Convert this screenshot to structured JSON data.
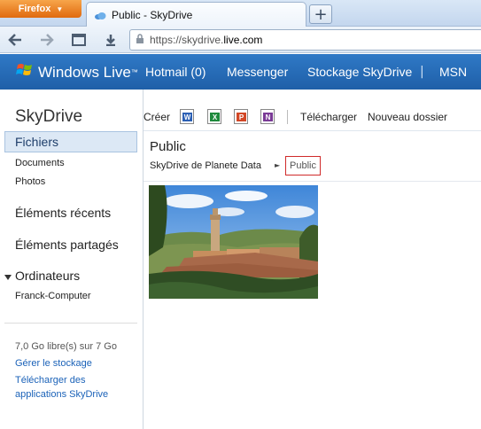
{
  "browser": {
    "app_button": "Firefox",
    "tab_title": "Public - SkyDrive",
    "new_tab_label": "+",
    "url_prefix": "https://skydrive.",
    "url_host": "live.com"
  },
  "header": {
    "brand": "Windows Live",
    "brand_tm": "™",
    "links": [
      "Hotmail (0)",
      "Messenger",
      "Stockage SkyDrive",
      "MSN"
    ],
    "separator": "|"
  },
  "sidebar": {
    "title": "SkyDrive",
    "selected": "Fichiers",
    "sub_items": [
      "Documents",
      "Photos"
    ],
    "recent": "Éléments récents",
    "shared": "Éléments partagés",
    "computers": "Ordinateurs",
    "computer_name": "Franck-Computer",
    "storage": "7,0 Go libre(s) sur 7 Go",
    "manage_storage": "Gérer le stockage",
    "download_apps_line1": "Télécharger des",
    "download_apps_line2": "applications SkyDrive"
  },
  "toolbar": {
    "create": "Créer",
    "doc_icons": [
      {
        "name": "word-doc-icon",
        "letter": "W",
        "color": "#2b5fb4"
      },
      {
        "name": "excel-doc-icon",
        "letter": "X",
        "color": "#1e8a3c"
      },
      {
        "name": "powerpoint-doc-icon",
        "letter": "P",
        "color": "#d24726"
      },
      {
        "name": "onenote-doc-icon",
        "letter": "N",
        "color": "#7a3b96"
      }
    ],
    "upload": "Télécharger",
    "new_folder": "Nouveau dossier"
  },
  "main": {
    "folder_title": "Public",
    "breadcrumb_root": "SkyDrive de Planete Data",
    "breadcrumb_arrow": "►",
    "breadcrumb_current": "Public",
    "photo_icon": "landscape-photo-thumbnail"
  },
  "colors": {
    "header_blue": "#2a6fbd",
    "link_blue": "#1b62b8",
    "selection_bg": "#dce8f5",
    "highlight_border": "#d02a2a"
  }
}
